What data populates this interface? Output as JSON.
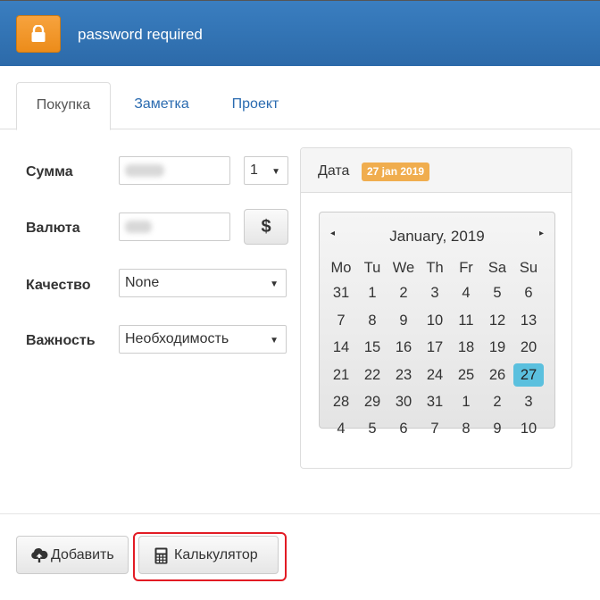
{
  "header": {
    "title": "password required",
    "lock_icon": "lock-icon",
    "accent": "#f0a135",
    "bar_color": "#2f73b5"
  },
  "tabs": [
    {
      "label": "Покупка",
      "active": true
    },
    {
      "label": "Заметка",
      "active": false
    },
    {
      "label": "Проект",
      "active": false
    }
  ],
  "form": {
    "amount_label": "Сумма",
    "amount_qty": "1",
    "currency_label": "Валюта",
    "currency_button": "$",
    "quality_label": "Качество",
    "quality_value": "None",
    "importance_label": "Важность",
    "importance_value": "Необходимость"
  },
  "date": {
    "label": "Дата",
    "badge": "27 jan 2019",
    "badge_color": "#f0ad4e"
  },
  "calendar": {
    "prev": "◂",
    "next": "▸",
    "title": "January, 2019",
    "weekdays": [
      "Mo",
      "Tu",
      "We",
      "Th",
      "Fr",
      "Sa",
      "Su"
    ],
    "weeks": [
      [
        "31",
        "1",
        "2",
        "3",
        "4",
        "5",
        "6"
      ],
      [
        "7",
        "8",
        "9",
        "10",
        "11",
        "12",
        "13"
      ],
      [
        "14",
        "15",
        "16",
        "17",
        "18",
        "19",
        "20"
      ],
      [
        "21",
        "22",
        "23",
        "24",
        "25",
        "26",
        "27"
      ],
      [
        "28",
        "29",
        "30",
        "31",
        "1",
        "2",
        "3"
      ],
      [
        "4",
        "5",
        "6",
        "7",
        "8",
        "9",
        "10"
      ]
    ],
    "selected": "27",
    "selected_color": "#5bc0de"
  },
  "footer": {
    "add_label": "Добавить",
    "add_icon": "cloud-upload-icon",
    "calc_label": "Калькулятор",
    "calc_icon": "calculator-icon",
    "highlight_color": "#e21b24"
  }
}
